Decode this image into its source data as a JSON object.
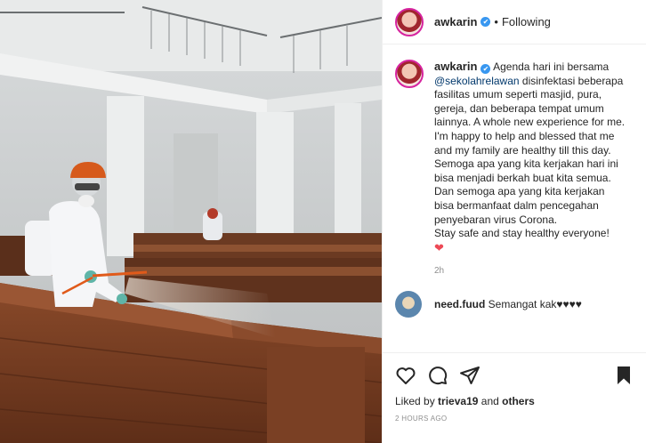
{
  "header": {
    "username": "awkarin",
    "verified_mark": "✔",
    "separator": "•",
    "follow_status": "Following"
  },
  "caption": {
    "username": "awkarin",
    "text_before": "Agenda hari ini bersama",
    "mention": "@sekolahrelawan",
    "text_after": "disinfektasi beberapa fasilitas umum seperti masjid, pura, gereja, dan beberapa tempat umum lainnya. A whole new experience for me. I'm happy to help and blessed that me and my family are healthy till this day.",
    "line2": "Semoga apa yang kita kerjakan hari ini bisa menjadi berkah buat kita semua.",
    "line3": "Dan semoga apa yang kita kerjakan bisa bermanfaat dalm pencegahan penyebaran virus Corona.",
    "line4": "Stay safe and stay healthy everyone!",
    "emoji": "❤",
    "age": "2h"
  },
  "comment": {
    "username": "need.fuud",
    "text": "Semangat kak♥♥♥♥"
  },
  "actions": {
    "icons": [
      "heart-icon",
      "comment-icon",
      "share-icon",
      "bookmark-icon"
    ]
  },
  "likes": {
    "prefix": "Liked by",
    "user": "trieva19",
    "joiner": "and",
    "others": "others"
  },
  "posted_time": "2 HOURS AGO",
  "colors": {
    "verified": "#3897f0",
    "mention": "#00376b",
    "heart": "#ed4956",
    "muted": "#8e8e8e"
  }
}
